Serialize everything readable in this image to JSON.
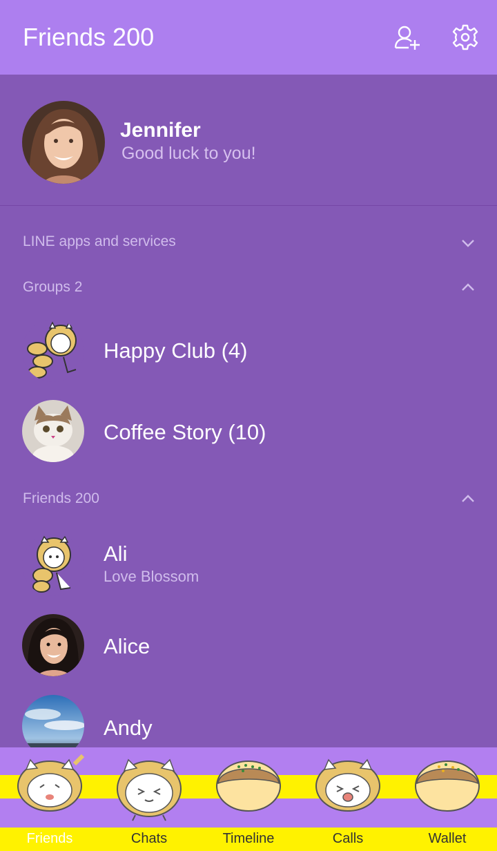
{
  "header": {
    "title": "Friends 200"
  },
  "profile": {
    "name": "Jennifer",
    "status": "Good luck to you!"
  },
  "sections": {
    "services": "LINE apps and services",
    "groups": "Groups 2",
    "friends": "Friends 200"
  },
  "groups": [
    {
      "name": "Happy Club (4)"
    },
    {
      "name": "Coffee Story (10)"
    }
  ],
  "friends": [
    {
      "name": "Ali",
      "status": "Love Blossom"
    },
    {
      "name": "Alice"
    },
    {
      "name": "Andy"
    }
  ],
  "tabs": [
    {
      "label": "Friends"
    },
    {
      "label": "Chats"
    },
    {
      "label": "Timeline"
    },
    {
      "label": "Calls"
    },
    {
      "label": "Wallet"
    }
  ],
  "colors": {
    "header": "#ad7fef",
    "background": "#8459b6",
    "accent": "#fff200"
  }
}
